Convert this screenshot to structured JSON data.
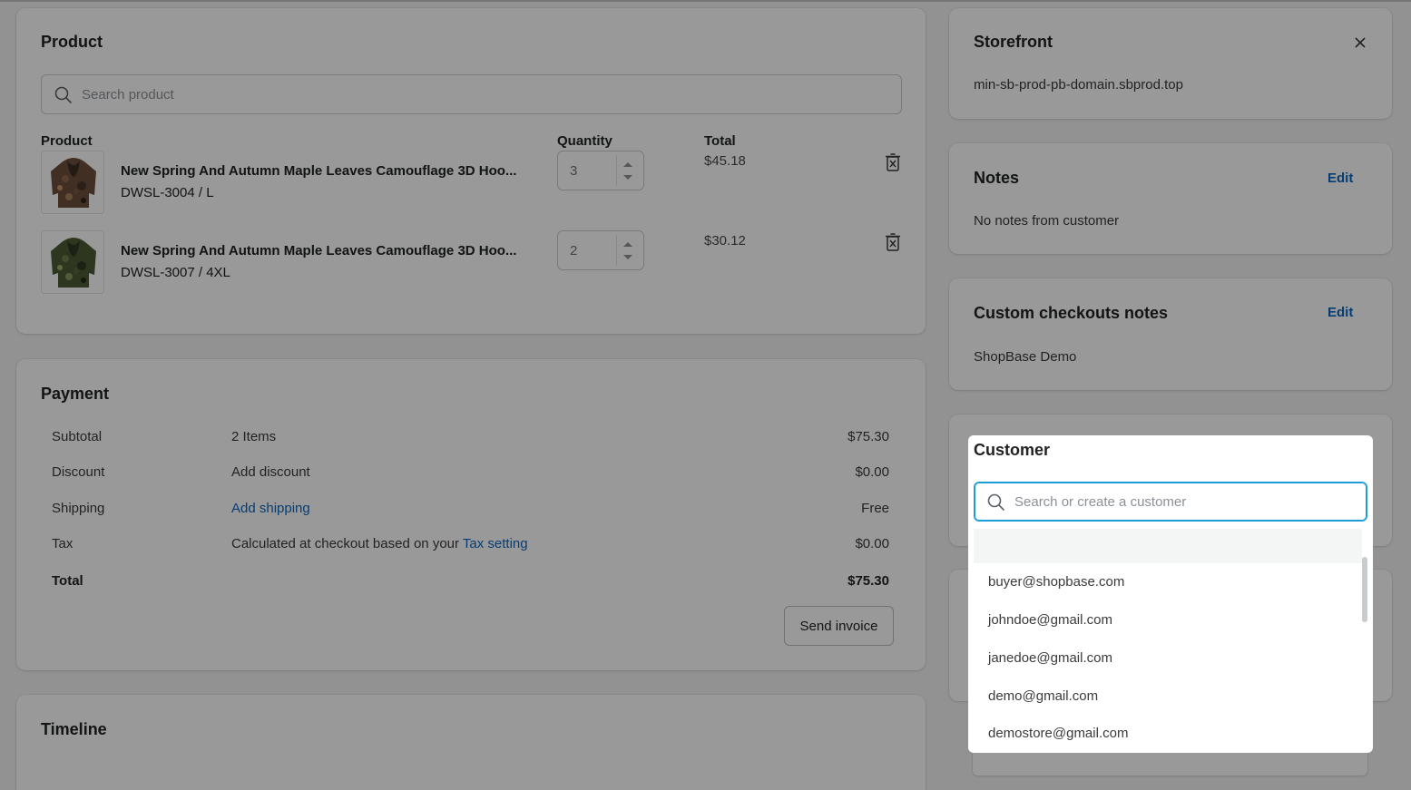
{
  "product_card": {
    "title": "Product",
    "search_placeholder": "Search product",
    "columns": {
      "product": "Product",
      "quantity": "Quantity",
      "total": "Total"
    },
    "items": [
      {
        "name": "New Spring And Autumn Maple Leaves Camouflage 3D Hoo...",
        "variant": "DWSL-3004 / L",
        "quantity": "3",
        "total": "$45.18",
        "image": "hoodie-camo-brown"
      },
      {
        "name": "New Spring And Autumn Maple Leaves Camouflage 3D Hoo...",
        "variant": "DWSL-3007 / 4XL",
        "quantity": "2",
        "total": "$30.12",
        "image": "hoodie-camo-green"
      }
    ]
  },
  "payment_card": {
    "title": "Payment",
    "rows": {
      "subtotal": {
        "label": "Subtotal",
        "detail": "2 Items",
        "value": "$75.30"
      },
      "discount": {
        "label": "Discount",
        "detail": "Add discount",
        "value": "$0.00"
      },
      "shipping": {
        "label": "Shipping",
        "detail": "Add shipping",
        "value": "Free"
      },
      "tax": {
        "label": "Tax",
        "detail_prefix": "Calculated at checkout based on your",
        "detail_link": "Tax setting",
        "value": "$0.00"
      },
      "total": {
        "label": "Total",
        "value": "$75.30"
      }
    },
    "send_invoice_label": "Send invoice"
  },
  "timeline_card": {
    "title": "Timeline"
  },
  "storefront_card": {
    "title": "Storefront",
    "domain": "min-sb-prod-pb-domain.sbprod.top"
  },
  "notes_card": {
    "title": "Notes",
    "edit_label": "Edit",
    "content": "No notes from customer"
  },
  "custom_notes_card": {
    "title": "Custom checkouts notes",
    "edit_label": "Edit",
    "content": "ShopBase Demo"
  },
  "customer_popover": {
    "title": "Customer",
    "search_placeholder": "Search or create a customer",
    "options": [
      "buyer@shopbase.com",
      "johndoe@gmail.com",
      "janedoe@gmail.com",
      "demo@gmail.com",
      "demostore@gmail.com"
    ]
  },
  "colors": {
    "link": "#0a66c2",
    "focus_border": "#1f9bd8",
    "overlay": "rgba(0,0,0,0.40)",
    "page_bg": "#f4f4f4"
  },
  "icons": {
    "search": "search-icon",
    "delete": "delete-icon",
    "close": "close-icon"
  }
}
